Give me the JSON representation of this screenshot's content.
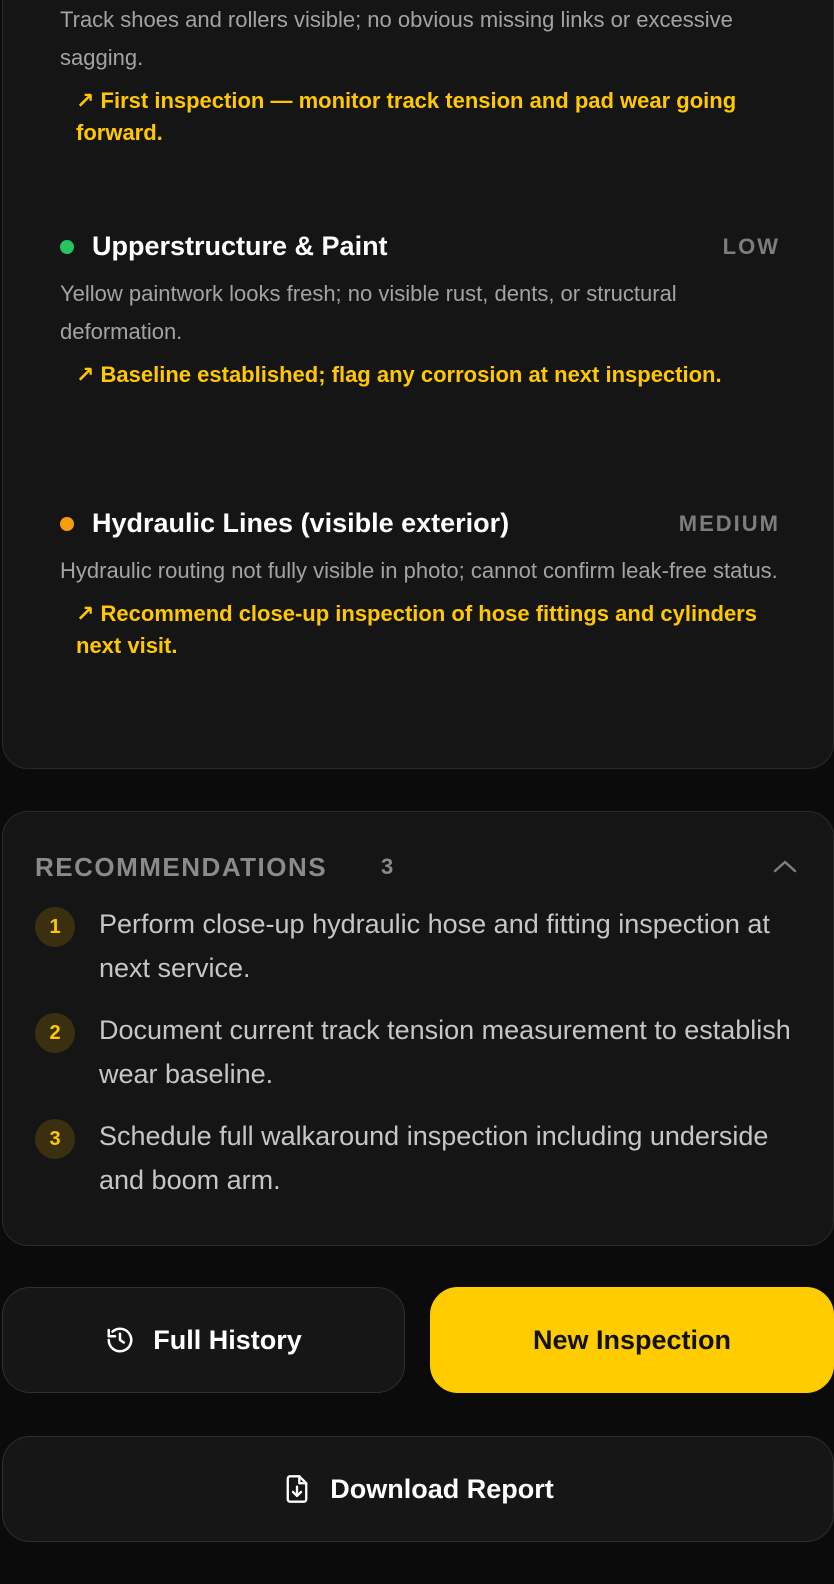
{
  "findings": [
    {
      "title": "",
      "severity": "",
      "status_color": "",
      "description": "Track shoes and rollers visible; no obvious missing links or excessive sagging.",
      "note": "↗ First inspection — monitor track tension and pad wear going forward."
    },
    {
      "title": "Upperstructure & Paint",
      "severity": "LOW",
      "status_color": "#22c55e",
      "description": "Yellow paintwork looks fresh; no visible rust, dents, or structural deformation.",
      "note": "↗ Baseline established; flag any corrosion at next inspection."
    },
    {
      "title": "Hydraulic Lines (visible exterior)",
      "severity": "MEDIUM",
      "status_color": "#f59e0b",
      "description": "Hydraulic routing not fully visible in photo; cannot confirm leak-free status.",
      "note": "↗ Recommend close-up inspection of hose fittings and cylinders next visit."
    }
  ],
  "recommendations": {
    "title": "RECOMMENDATIONS",
    "count": "3",
    "toggle_icon": "chevron-up-icon",
    "items": [
      {
        "number": "1",
        "text": "Perform close-up hydraulic hose and fitting inspection at next service."
      },
      {
        "number": "2",
        "text": "Document current track tension measurement to establish wear baseline."
      },
      {
        "number": "3",
        "text": "Schedule full walkaround inspection including underside and boom arm."
      }
    ]
  },
  "actions": {
    "history_label": "Full History",
    "history_icon": "history-icon",
    "new_inspection_label": "New Inspection",
    "download_label": "Download Report",
    "download_icon": "file-download-icon"
  },
  "colors": {
    "accent": "#ffcc00",
    "low": "#22c55e",
    "medium": "#f59e0b",
    "card_bg": "#151515",
    "page_bg": "#0b0b0b"
  }
}
